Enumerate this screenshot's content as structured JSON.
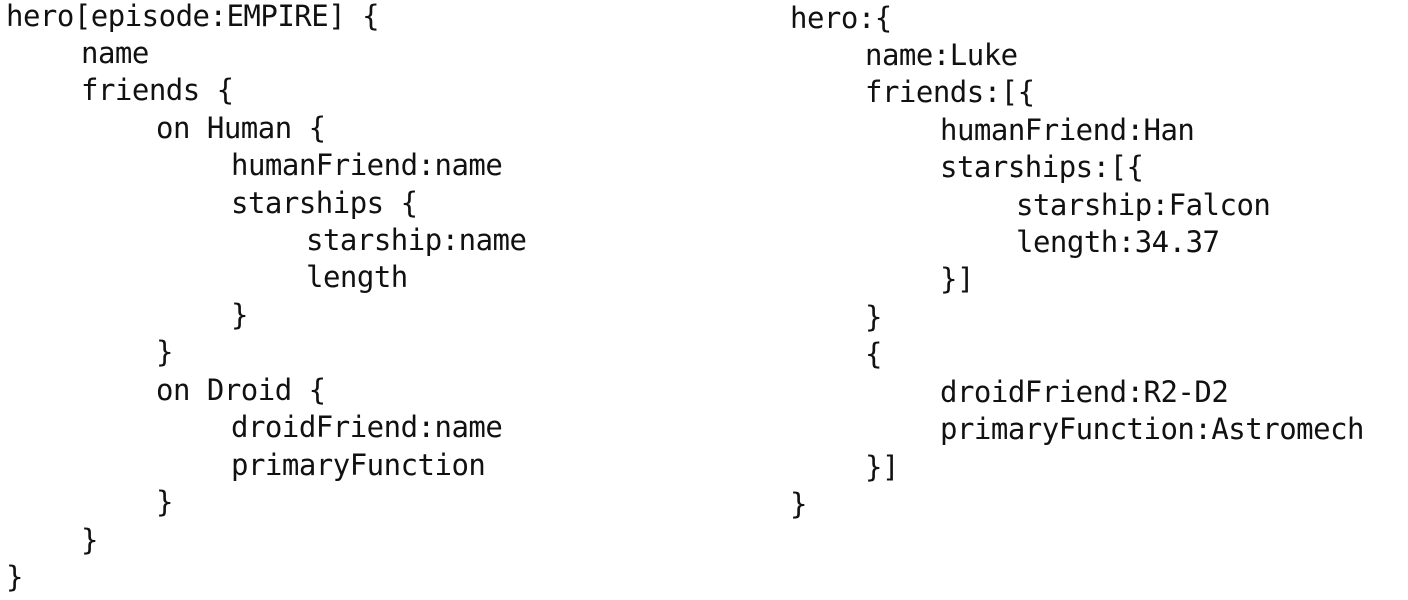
{
  "query": {
    "lines": [
      "hero[episode:EMPIRE] {",
      "name",
      "friends {",
      "on Human {",
      "humanFriend:name",
      "starships {",
      "starship:name",
      "length",
      "}",
      "}",
      "on Droid {",
      "droidFriend:name",
      "primaryFunction",
      "}",
      "}",
      "}"
    ]
  },
  "result": {
    "lines": [
      "hero:{",
      "name:Luke",
      "friends:[{",
      "humanFriend:Han",
      "starships:[{",
      "starship:Falcon",
      "length:34.37",
      "}]",
      "}",
      "{",
      "droidFriend:R2-D2",
      "primaryFunction:Astromech",
      "}]",
      "}"
    ]
  }
}
